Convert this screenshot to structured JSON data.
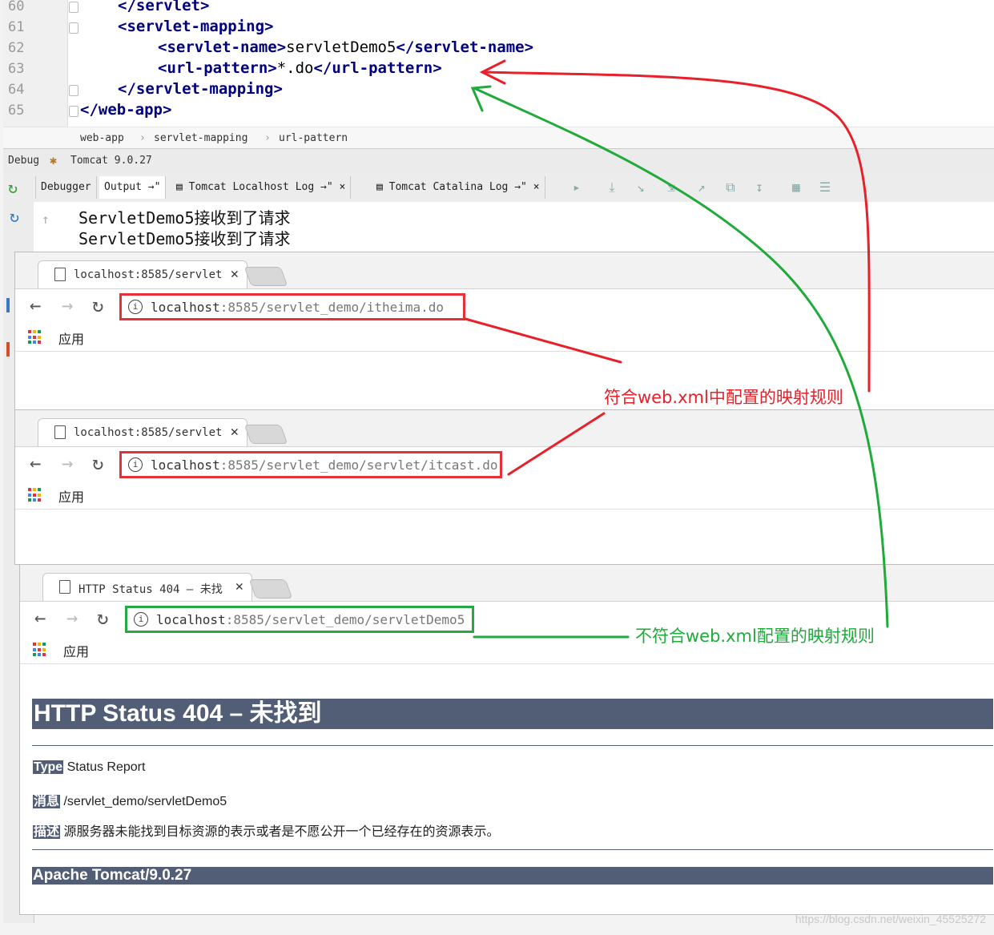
{
  "editor": {
    "lines": [
      {
        "num": "60",
        "code": "</servlet>"
      },
      {
        "num": "61",
        "code": "<servlet-mapping>"
      },
      {
        "num": "62",
        "tag_open": "<servlet-name>",
        "text": "servletDemo5",
        "tag_close": "</servlet-name>"
      },
      {
        "num": "63",
        "tag_open": "<url-pattern>",
        "text": "*.do",
        "tag_close": "</url-pattern>"
      },
      {
        "num": "64",
        "code": "</servlet-mapping>"
      },
      {
        "num": "65",
        "code": "</web-app>"
      }
    ],
    "breadcrumbs": [
      "web-app",
      "servlet-mapping",
      "url-pattern"
    ]
  },
  "debug": {
    "label": "Debug",
    "config": "Tomcat 9.0.27",
    "tabs": [
      "Debugger",
      "Output",
      "Tomcat Localhost Log",
      "Tomcat Catalina Log"
    ],
    "tab_suffix": "→\"",
    "output_lines": [
      "ServletDemo5接收到了请求",
      "ServletDemo5接收到了请求"
    ]
  },
  "browsers": [
    {
      "tab_title": "localhost:8585/servlet",
      "url_host": "localhost",
      "url_rest": ":8585/servlet_demo/itheima.do",
      "bookmark": "应用"
    },
    {
      "tab_title": "localhost:8585/servlet",
      "url_host": "localhost",
      "url_rest": ":8585/servlet_demo/servlet/itcast.do",
      "bookmark": "应用"
    },
    {
      "tab_title": "HTTP Status 404 – 未找",
      "url_host": "localhost",
      "url_rest": ":8585/servlet_demo/servletDemo5",
      "bookmark": "应用"
    }
  ],
  "error_page": {
    "heading": "HTTP Status 404 – 未找到",
    "type_label": "Type",
    "type_value": "Status Report",
    "msg_label": "消息",
    "msg_value": "/servlet_demo/servletDemo5",
    "desc_label": "描述",
    "desc_value": "源服务器未能找到目标资源的表示或者是不愿公开一个已经存在的资源表示。",
    "footer": "Apache Tomcat/9.0.27"
  },
  "annotations": {
    "match": "符合web.xml中配置的映射规则",
    "nomatch": "不符合web.xml配置的映射规则",
    "match_color": "#e8202a",
    "nomatch_color": "#1faa3a"
  },
  "watermark": "https://blog.csdn.net/weixin_45525272"
}
